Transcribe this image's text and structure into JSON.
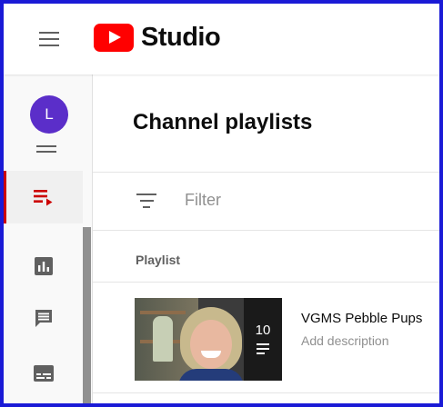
{
  "header": {
    "app_name": "Studio",
    "icons": {
      "menu": "hamburger-menu-icon",
      "logo": "youtube-logo-icon"
    }
  },
  "sidebar": {
    "avatar_letter": "L",
    "items": [
      {
        "icon": "content-list-icon",
        "active": false
      },
      {
        "icon": "playlists-icon",
        "active": true
      },
      {
        "icon": "analytics-icon",
        "active": false
      },
      {
        "icon": "comments-icon",
        "active": false
      },
      {
        "icon": "subtitles-icon",
        "active": false
      }
    ]
  },
  "main": {
    "title": "Channel playlists",
    "filter_placeholder": "Filter",
    "column_header": "Playlist",
    "playlists": [
      {
        "title": "VGMS Pebble Pups",
        "description": "Add description",
        "video_count": "10"
      }
    ]
  },
  "colors": {
    "brand": "#ff0000",
    "active": "#cc0000",
    "avatar": "#5b2ec9",
    "border": "#1a1ad6"
  }
}
